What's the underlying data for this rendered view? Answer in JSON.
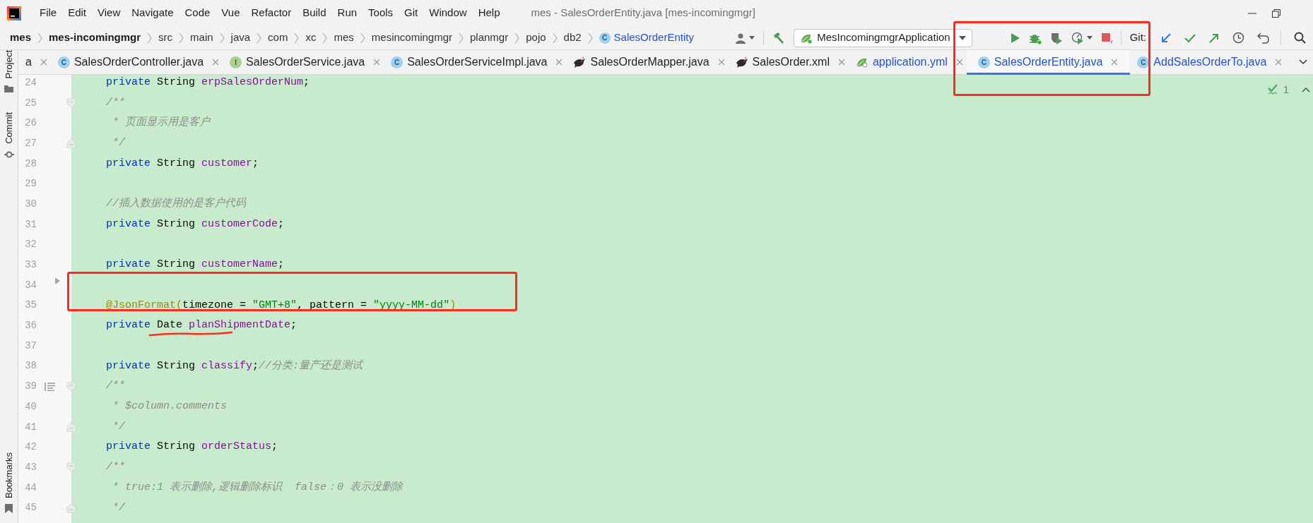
{
  "menu_bar": {
    "items": [
      "File",
      "Edit",
      "View",
      "Navigate",
      "Code",
      "Vue",
      "Refactor",
      "Build",
      "Run",
      "Tools",
      "Git",
      "Window",
      "Help"
    ],
    "title": "mes - SalesOrderEntity.java [mes-incomingmgr]"
  },
  "breadcrumbs": [
    {
      "kind": "module",
      "text": "mes"
    },
    {
      "kind": "module",
      "text": "mes-incomingmgr"
    },
    {
      "kind": "folder",
      "text": "src"
    },
    {
      "kind": "folder",
      "text": "main"
    },
    {
      "kind": "folder",
      "text": "java"
    },
    {
      "kind": "folder",
      "text": "com"
    },
    {
      "kind": "folder",
      "text": "xc"
    },
    {
      "kind": "folder",
      "text": "mes"
    },
    {
      "kind": "folder",
      "text": "mesincomingmgr"
    },
    {
      "kind": "folder",
      "text": "planmgr"
    },
    {
      "kind": "folder",
      "text": "pojo"
    },
    {
      "kind": "folder",
      "text": "db2"
    },
    {
      "kind": "class",
      "icon_text": "C",
      "text": "SalesOrderEntity"
    }
  ],
  "toolbar": {
    "run_configuration": "MesIncomingmgrApplication",
    "git_label": "Git:"
  },
  "tabs": [
    {
      "label": "a",
      "kind": "plain",
      "color": "#1f1f1f",
      "selected": false
    },
    {
      "label": "SalesOrderController.java",
      "kind": "class",
      "icon_text": "C",
      "color": "#1f1f1f",
      "selected": false
    },
    {
      "label": "SalesOrderService.java",
      "kind": "interface",
      "icon_text": "I",
      "color": "#1f1f1f",
      "selected": false
    },
    {
      "label": "SalesOrderServiceImpl.java",
      "kind": "class",
      "icon_text": "C",
      "color": "#1f1f1f",
      "selected": false
    },
    {
      "label": "SalesOrderMapper.java",
      "kind": "mybatis",
      "color": "#1f1f1f",
      "selected": false
    },
    {
      "label": "SalesOrder.xml",
      "kind": "mybatis",
      "color": "#1f1f1f",
      "selected": false
    },
    {
      "label": "application.yml",
      "kind": "spring",
      "color": "#2750c4",
      "selected": false
    },
    {
      "label": "SalesOrderEntity.java",
      "kind": "class",
      "icon_text": "C",
      "color": "#2750c4",
      "selected": true
    },
    {
      "label": "AddSalesOrderTo.java",
      "kind": "class",
      "icon_text": "C",
      "color": "#2750c4",
      "selected": false
    }
  ],
  "tool_windows": [
    {
      "label": "Project",
      "kind": "folder"
    },
    {
      "label": "Commit",
      "kind": "commit"
    },
    {
      "label": "Bookmarks",
      "kind": "bookmark"
    }
  ],
  "editor": {
    "inspection_count": "1",
    "lines": [
      {
        "number": "24",
        "kind": "plain",
        "tokens": [
          {
            "kind": "keyword",
            "text": "private"
          },
          {
            "kind": "plain",
            "text": " String "
          },
          {
            "kind": "field",
            "text": "erpSalesOrderNum"
          },
          {
            "kind": "plain",
            "text": ";"
          }
        ]
      },
      {
        "number": "25",
        "kind": "open",
        "tokens": [
          {
            "kind": "comment",
            "text": "/**"
          }
        ]
      },
      {
        "number": "26",
        "kind": "plain",
        "tokens": [
          {
            "kind": "comment",
            "text": " * 页面显示用是客户"
          }
        ]
      },
      {
        "number": "27",
        "kind": "close",
        "tokens": [
          {
            "kind": "comment",
            "text": " */"
          }
        ]
      },
      {
        "number": "28",
        "kind": "plain",
        "tokens": [
          {
            "kind": "keyword",
            "text": "private"
          },
          {
            "kind": "plain",
            "text": " String "
          },
          {
            "kind": "field",
            "text": "customer"
          },
          {
            "kind": "plain",
            "text": ";"
          }
        ]
      },
      {
        "number": "29",
        "kind": "plain"
      },
      {
        "number": "30",
        "kind": "plain",
        "tokens": [
          {
            "kind": "comment",
            "text": "//插入数据使用的是客户代码"
          }
        ]
      },
      {
        "number": "31",
        "kind": "plain",
        "tokens": [
          {
            "kind": "keyword",
            "text": "private"
          },
          {
            "kind": "plain",
            "text": " String "
          },
          {
            "kind": "field",
            "text": "customerCode"
          },
          {
            "kind": "plain",
            "text": ";"
          }
        ]
      },
      {
        "number": "32",
        "kind": "plain"
      },
      {
        "number": "33",
        "kind": "plain",
        "tokens": [
          {
            "kind": "keyword",
            "text": "private"
          },
          {
            "kind": "plain",
            "text": " String "
          },
          {
            "kind": "field",
            "text": "customerName"
          },
          {
            "kind": "plain",
            "text": ";"
          }
        ]
      },
      {
        "number": "34",
        "kind": "pointer"
      },
      {
        "number": "35",
        "kind": "plain",
        "tokens": [
          {
            "kind": "annotation",
            "text": "@JsonFormat("
          },
          {
            "kind": "plain",
            "text": "timezone = "
          },
          {
            "kind": "string",
            "text": "\"GMT+8\""
          },
          {
            "kind": "plain",
            "text": ", pattern = "
          },
          {
            "kind": "string",
            "text": "\"yyyy-MM-dd\""
          },
          {
            "kind": "annotation",
            "text": ")"
          }
        ]
      },
      {
        "number": "36",
        "kind": "plain",
        "tokens": [
          {
            "kind": "keyword",
            "text": "private"
          },
          {
            "kind": "plain",
            "text": " Date "
          },
          {
            "kind": "field",
            "text": "planShipmentDate"
          },
          {
            "kind": "plain",
            "text": ";"
          }
        ]
      },
      {
        "number": "37",
        "kind": "plain"
      },
      {
        "number": "38",
        "kind": "plain",
        "tokens": [
          {
            "kind": "keyword",
            "text": "private"
          },
          {
            "kind": "plain",
            "text": " String "
          },
          {
            "kind": "field",
            "text": "classify"
          },
          {
            "kind": "plain",
            "text": ";"
          },
          {
            "kind": "comment",
            "text": "//分类:量产还是测试"
          }
        ]
      },
      {
        "number": "39",
        "kind": "docopen",
        "tokens": [
          {
            "kind": "comment",
            "text": "/**"
          }
        ]
      },
      {
        "number": "40",
        "kind": "plain",
        "tokens": [
          {
            "kind": "comment",
            "text": " * $column.comments"
          }
        ]
      },
      {
        "number": "41",
        "kind": "close",
        "tokens": [
          {
            "kind": "comment",
            "text": " */"
          }
        ]
      },
      {
        "number": "42",
        "kind": "plain",
        "tokens": [
          {
            "kind": "keyword",
            "text": "private"
          },
          {
            "kind": "plain",
            "text": " String "
          },
          {
            "kind": "field",
            "text": "orderStatus"
          },
          {
            "kind": "plain",
            "text": ";"
          }
        ]
      },
      {
        "number": "43",
        "kind": "open",
        "tokens": [
          {
            "kind": "comment",
            "text": "/**"
          }
        ]
      },
      {
        "number": "44",
        "kind": "plain",
        "tokens": [
          {
            "kind": "comment",
            "text": " * true:1 表示删除,逻辑删除标识  false：0 表示没删除"
          }
        ]
      },
      {
        "number": "45",
        "kind": "close",
        "tokens": [
          {
            "kind": "comment",
            "text": " */"
          }
        ]
      }
    ]
  }
}
